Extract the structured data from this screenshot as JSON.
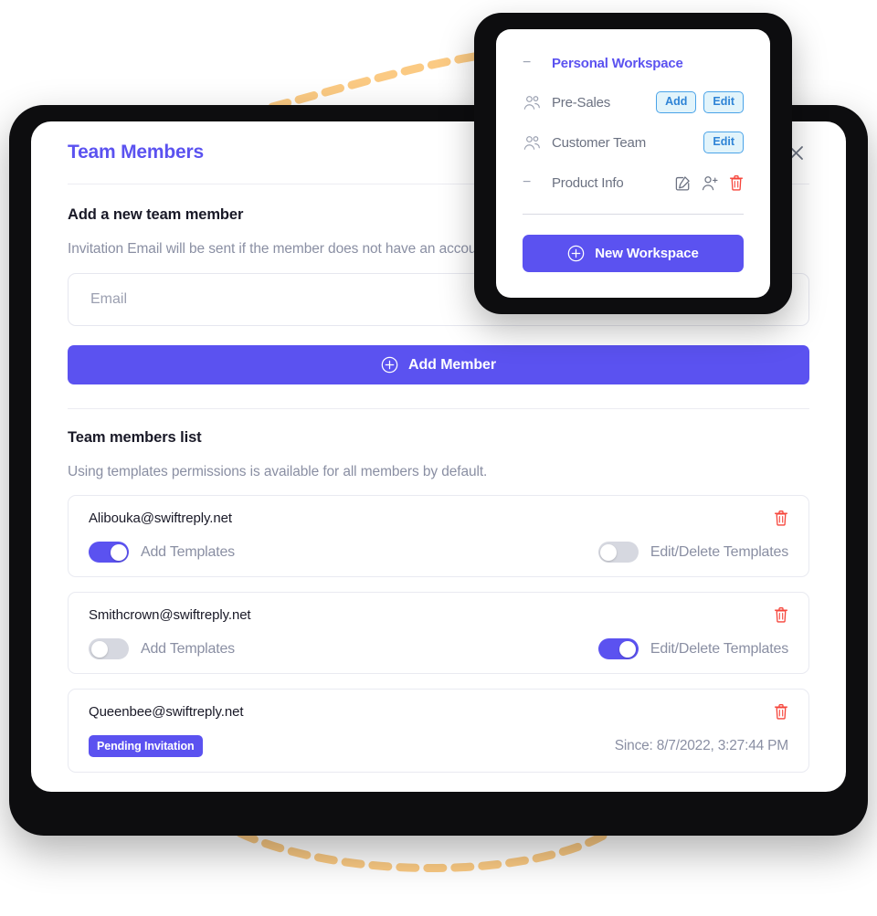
{
  "panel": {
    "title": "Team Members",
    "close_icon": "close-icon",
    "add_section": {
      "heading": "Add a new team member",
      "subtitle": "Invitation Email will be sent if the member does not have an account.",
      "email_placeholder": "Email",
      "email_value": "",
      "add_member_label": "Add Member",
      "add_member_icon": "plus-circle-icon"
    },
    "list_section": {
      "heading": "Team members list",
      "subtitle": "Using templates permissions is available for all members by default.",
      "members": [
        {
          "email": "Alibouka@swiftreply.net",
          "delete_icon": "trash-icon",
          "add_templates_label": "Add Templates",
          "add_templates_on": true,
          "edit_delete_label": "Edit/Delete Templates",
          "edit_delete_on": false,
          "pending": false
        },
        {
          "email": "Smithcrown@swiftreply.net",
          "delete_icon": "trash-icon",
          "add_templates_label": "Add Templates",
          "add_templates_on": false,
          "edit_delete_label": "Edit/Delete Templates",
          "edit_delete_on": true,
          "pending": false
        },
        {
          "email": "Queenbee@swiftreply.net",
          "delete_icon": "trash-icon",
          "pending": true,
          "badge": "Pending Invitation",
          "since": "Since: 8/7/2022, 3:27:44 PM"
        }
      ]
    }
  },
  "workspace_popup": {
    "collapse_icon": "minus-icon",
    "title": "Personal Workspace",
    "rows": [
      {
        "icon": "group-people-icon",
        "name": "Pre-Sales",
        "buttons": [
          "Add",
          "Edit"
        ],
        "icon_buttons": []
      },
      {
        "icon": "group-people-icon",
        "name": "Customer Team",
        "buttons": [
          "Edit"
        ],
        "icon_buttons": []
      },
      {
        "icon": "minus-icon",
        "name": "Product Info",
        "buttons": [],
        "icon_buttons": [
          "edit-square-icon",
          "add-person-icon",
          "trash-icon"
        ]
      }
    ],
    "new_workspace_label": "New Workspace",
    "new_workspace_icon": "plus-circle-icon"
  },
  "colors": {
    "accent": "#5b52f0",
    "pill_border": "#4aa3e8",
    "pill_bg": "#e2f4fb",
    "pill_text": "#2e83d6",
    "danger": "#f6443a",
    "muted": "#8a8fa3",
    "dashed_connector": "#fbca83",
    "bezel": "#0d0d0f"
  }
}
